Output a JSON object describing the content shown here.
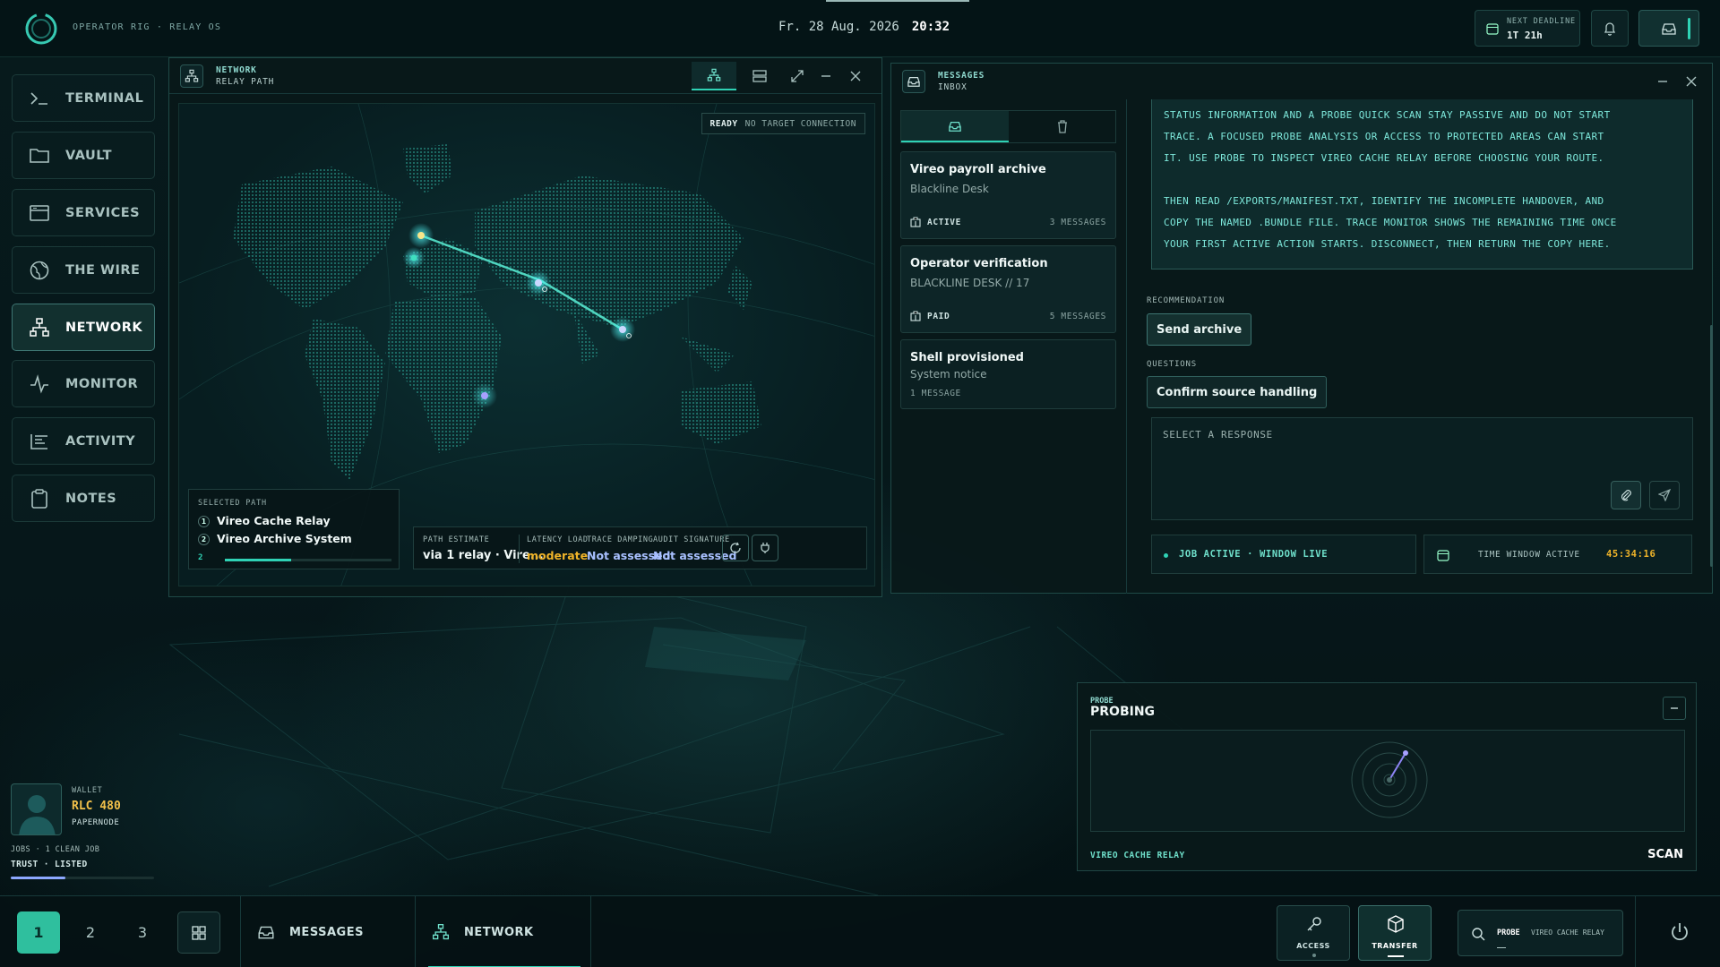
{
  "app": {
    "name": "OPERATOR RIG · RELAY OS",
    "date": "Fr. 28 Aug. 2026",
    "time": "20:32"
  },
  "deadline": {
    "label": "NEXT DEADLINE",
    "value": "1T 21h"
  },
  "sidebar": {
    "items": [
      {
        "label": "TERMINAL",
        "icon": "terminal-icon"
      },
      {
        "label": "VAULT",
        "icon": "folder-icon"
      },
      {
        "label": "SERVICES",
        "icon": "browser-icon"
      },
      {
        "label": "THE WIRE",
        "icon": "globe-icon"
      },
      {
        "label": "NETWORK",
        "icon": "network-icon",
        "active": true
      },
      {
        "label": "MONITOR",
        "icon": "pulse-icon"
      },
      {
        "label": "ACTIVITY",
        "icon": "list-icon"
      },
      {
        "label": "NOTES",
        "icon": "clipboard-icon"
      }
    ]
  },
  "wallet": {
    "label": "WALLET",
    "amount": "RLC 480",
    "node": "PAPERNODE",
    "jobs": "JOBS · 1 CLEAN JOB",
    "trust": "TRUST · LISTED",
    "trust_level": 0.38
  },
  "network": {
    "title": "NETWORK",
    "subtitle": "RELAY PATH",
    "status": {
      "state": "READY",
      "detail": "NO TARGET CONNECTION"
    },
    "selected_path": {
      "label": "SELECTED PATH",
      "hops": [
        {
          "n": "1",
          "name": "Vireo Cache Relay"
        },
        {
          "n": "2",
          "name": "Vireo Archive System"
        }
      ],
      "step": "2",
      "progress": 0.4
    },
    "estimate": {
      "path_label": "PATH ESTIMATE",
      "path_value": "via 1 relay · Vire...",
      "latency_label": "LATENCY LOAD",
      "latency_value": "moderate",
      "trace_label": "TRACE DAMPING",
      "trace_value": "Not assessed",
      "audit_label": "AUDIT SIGNATURE",
      "audit_value": "Not assessed"
    }
  },
  "messages": {
    "title": "MESSAGES",
    "subtitle": "INBOX",
    "list": [
      {
        "title": "Vireo payroll archive",
        "sender": "Blackline Desk",
        "status": "ACTIVE",
        "count": "3 MESSAGES"
      },
      {
        "title": "Operator verification",
        "sender": "BLACKLINE DESK // 17",
        "status": "PAID",
        "count": "5 MESSAGES"
      },
      {
        "title": "Shell provisioned",
        "sender": "System notice",
        "count": "1 MESSAGE"
      }
    ],
    "body": [
      "STATUS INFORMATION AND A PROBE QUICK SCAN STAY PASSIVE AND DO NOT START",
      "TRACE. A FOCUSED PROBE ANALYSIS OR ACCESS TO PROTECTED AREAS CAN START",
      "IT. USE PROBE TO INSPECT VIREO CACHE RELAY BEFORE CHOOSING YOUR ROUTE.",
      "",
      "THEN READ /EXPORTS/MANIFEST.TXT, IDENTIFY THE INCOMPLETE HANDOVER, AND",
      "COPY THE NAMED .BUNDLE FILE. TRACE MONITOR SHOWS THE REMAINING TIME ONCE",
      "YOUR FIRST ACTIVE ACTION STARTS. DISCONNECT, THEN RETURN THE COPY HERE."
    ],
    "recommendation_label": "RECOMMENDATION",
    "recommendation": "Send archive",
    "questions_label": "QUESTIONS",
    "question": "Confirm source handling",
    "response_placeholder": "SELECT A RESPONSE",
    "job_status": "JOB ACTIVE · WINDOW LIVE",
    "window_label": "TIME WINDOW ACTIVE",
    "window_time": "45:34:16"
  },
  "probe": {
    "title": "PROBE",
    "state": "PROBING",
    "target": "VIREO CACHE RELAY",
    "action": "SCAN"
  },
  "taskbar": {
    "workspaces": [
      "1",
      "2",
      "3"
    ],
    "tasks": [
      "MESSAGES",
      "NETWORK"
    ],
    "access": "ACCESS",
    "transfer": "TRANSFER",
    "search_tool": "PROBE",
    "search_target": "VIREO CACHE RELAY"
  },
  "colors": {
    "accent": "#2fd2b5",
    "warn": "#f0b429",
    "muted": "#a8c0ff"
  }
}
